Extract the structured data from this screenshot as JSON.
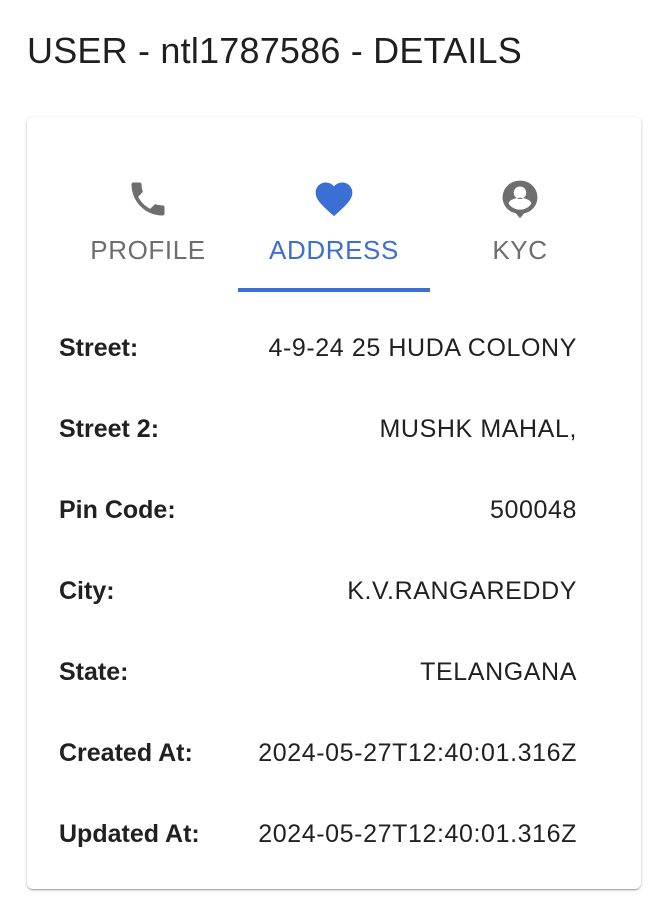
{
  "page": {
    "title": "USER - ntl1787586 - DETAILS"
  },
  "tabs": [
    {
      "label": "PROFILE",
      "icon": "phone-icon",
      "active": false
    },
    {
      "label": "ADDRESS",
      "icon": "heart-icon",
      "active": true
    },
    {
      "label": "KYC",
      "icon": "account-circle-icon",
      "active": false
    }
  ],
  "address": [
    {
      "label": "Street:",
      "value": "4-9-24 25 HUDA COLONY"
    },
    {
      "label": "Street 2:",
      "value": "MUSHK MAHAL,"
    },
    {
      "label": "Pin Code:",
      "value": "500048"
    },
    {
      "label": "City:",
      "value": "K.V.RANGAREDDY"
    },
    {
      "label": "State:",
      "value": "TELANGANA"
    },
    {
      "label": "Created At:",
      "value": "2024-05-27T12:40:01.316Z"
    },
    {
      "label": "Updated At:",
      "value": "2024-05-27T12:40:01.316Z"
    }
  ],
  "colors": {
    "accent": "#3b6fd4",
    "inactive_tab": "#6e6e6e",
    "text": "#212121"
  }
}
